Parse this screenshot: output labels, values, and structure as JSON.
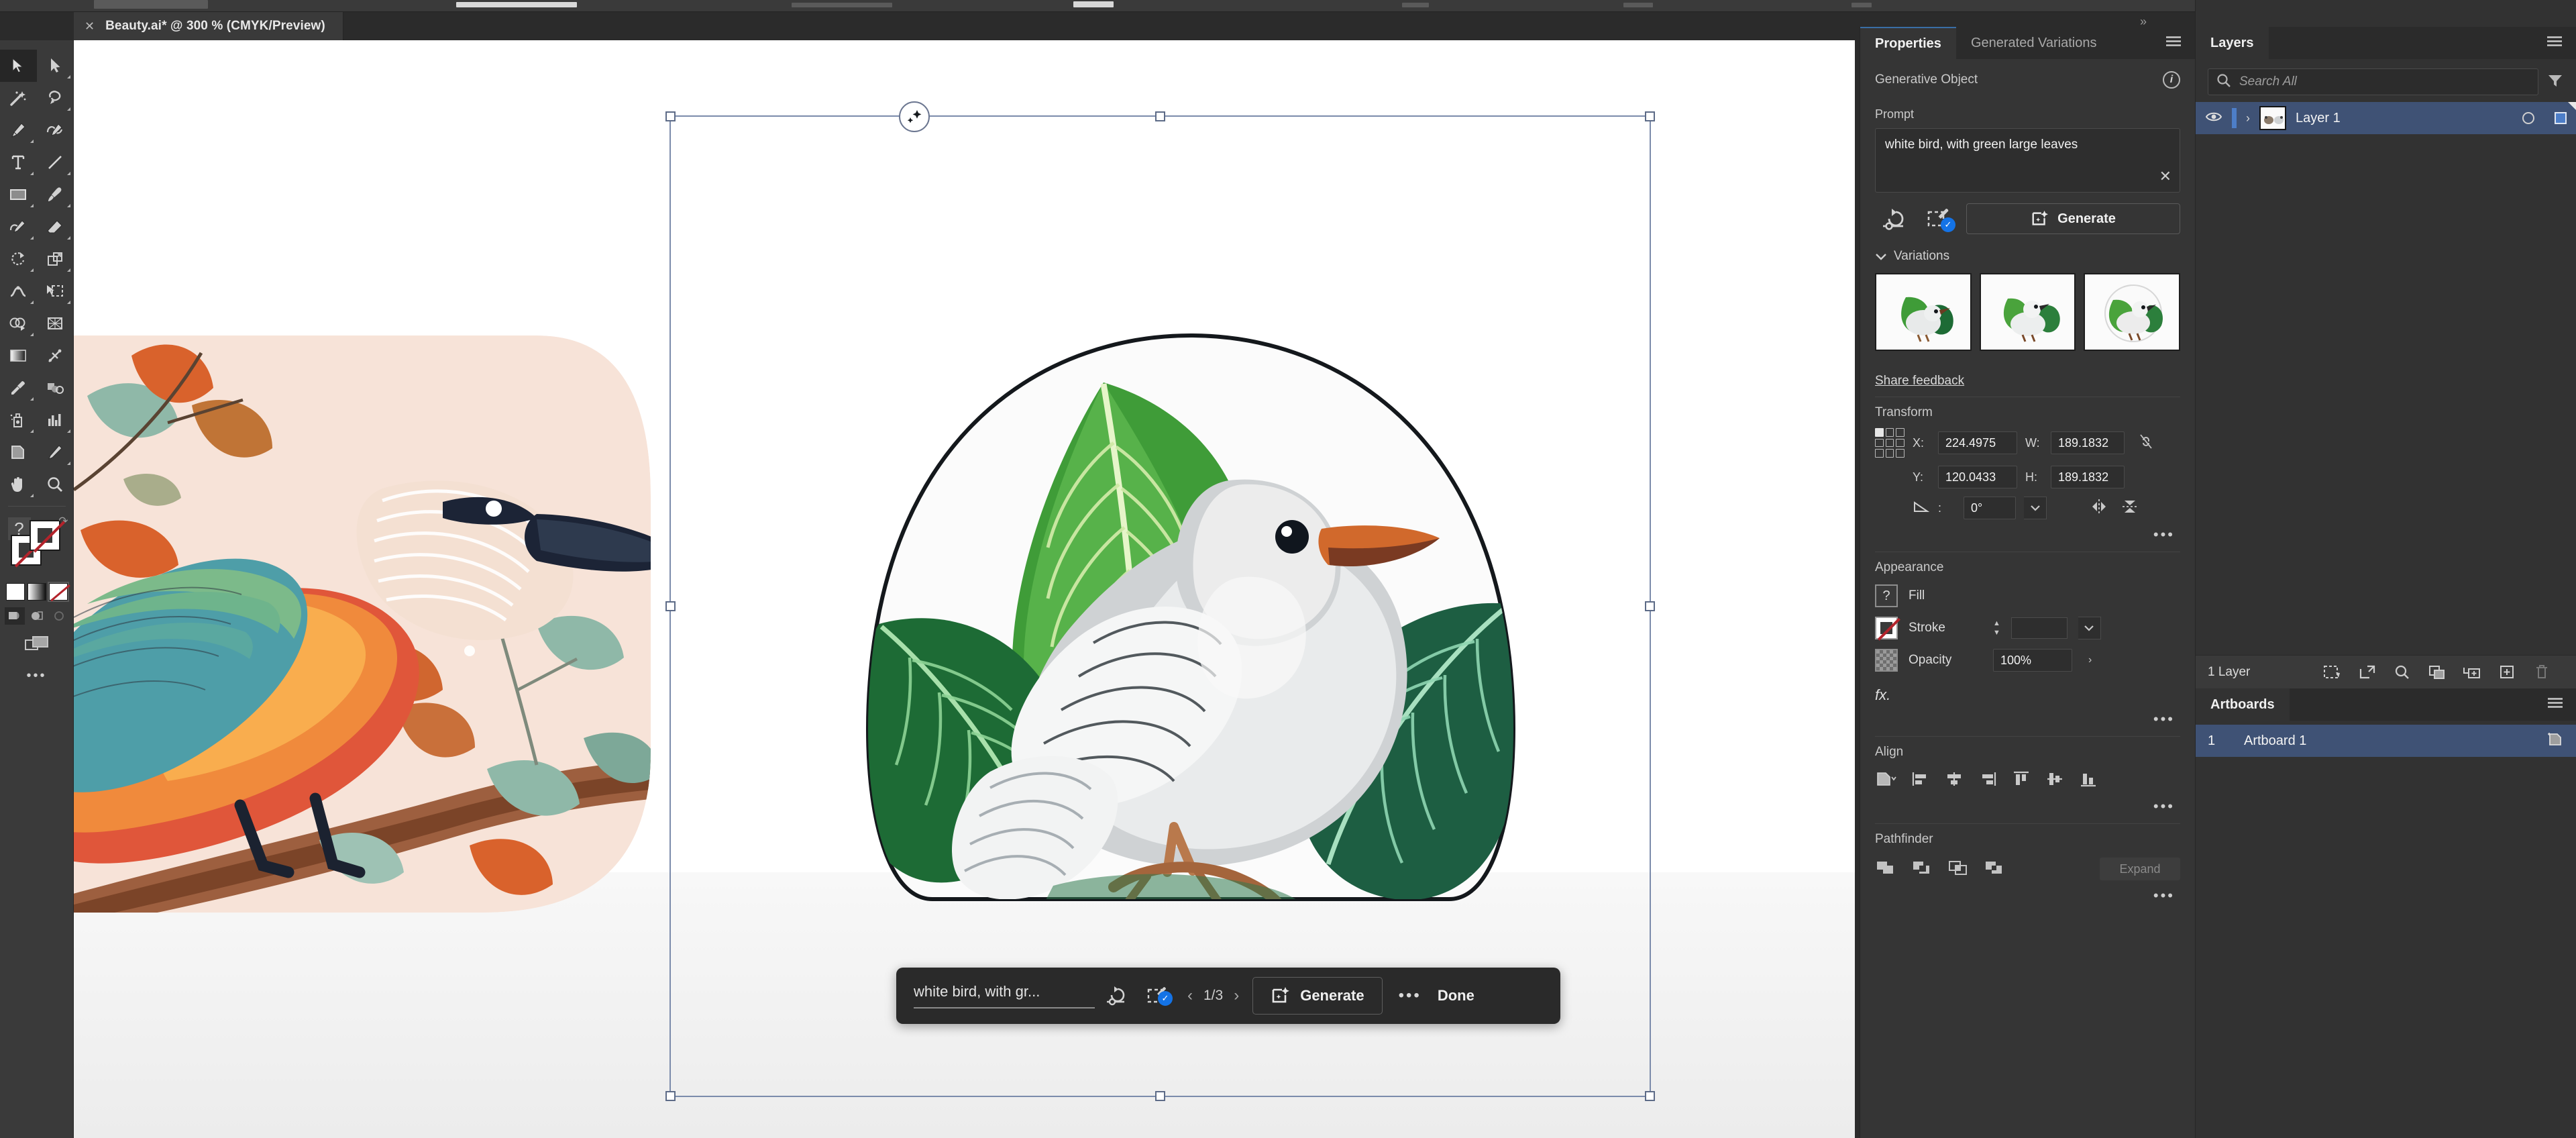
{
  "app": {
    "document_tab": {
      "title": "Beauty.ai* @ 300 % (CMYK/Preview)",
      "close_label": "✕"
    }
  },
  "toolbar": {
    "tools": [
      {
        "name": "selection-tool",
        "label": "Selection"
      },
      {
        "name": "direct-selection-tool",
        "label": "Direct Selection"
      },
      {
        "name": "magic-wand-tool",
        "label": "Magic Wand"
      },
      {
        "name": "lasso-tool",
        "label": "Lasso"
      },
      {
        "name": "pen-tool",
        "label": "Pen"
      },
      {
        "name": "curvature-tool",
        "label": "Curvature"
      },
      {
        "name": "type-tool",
        "label": "Type"
      },
      {
        "name": "line-segment-tool",
        "label": "Line Segment"
      },
      {
        "name": "rectangle-tool",
        "label": "Rectangle"
      },
      {
        "name": "paintbrush-tool",
        "label": "Paintbrush"
      },
      {
        "name": "shaper-tool",
        "label": "Shaper"
      },
      {
        "name": "eraser-tool",
        "label": "Eraser"
      },
      {
        "name": "rotate-tool",
        "label": "Rotate"
      },
      {
        "name": "scale-tool",
        "label": "Scale"
      },
      {
        "name": "width-tool",
        "label": "Width"
      },
      {
        "name": "free-transform-tool",
        "label": "Free Transform"
      },
      {
        "name": "shape-builder-tool",
        "label": "Shape Builder"
      },
      {
        "name": "perspective-grid-tool",
        "label": "Perspective Grid"
      },
      {
        "name": "gradient-tool",
        "label": "Gradient"
      },
      {
        "name": "mesh-tool",
        "label": "Mesh"
      },
      {
        "name": "eyedropper-tool",
        "label": "Eyedropper"
      },
      {
        "name": "blend-tool",
        "label": "Blend"
      },
      {
        "name": "symbol-sprayer-tool",
        "label": "Symbol Sprayer"
      },
      {
        "name": "column-graph-tool",
        "label": "Column Graph"
      },
      {
        "name": "artboard-tool",
        "label": "Artboard"
      },
      {
        "name": "slice-tool",
        "label": "Slice"
      },
      {
        "name": "hand-tool",
        "label": "Hand"
      },
      {
        "name": "zoom-tool",
        "label": "Zoom"
      }
    ],
    "selected_tool": "selection-tool",
    "fill_label": "Fill",
    "stroke_label": "Stroke",
    "fill_state": "?",
    "stroke_state": "none",
    "color_modes": [
      "color",
      "gradient",
      "none"
    ],
    "active_color_mode": "none",
    "draw_modes": [
      "draw-normal",
      "draw-behind",
      "draw-inside"
    ],
    "active_draw_mode": "draw-normal",
    "more_label": "•••"
  },
  "canvas": {
    "zoom_level": "300 %",
    "color_mode": "CMYK",
    "view_mode": "Preview",
    "selection": {
      "visible": true,
      "badge": "generative-object-badge"
    }
  },
  "gen_toolbar": {
    "prompt_text": "white bird, with gr...",
    "icons": [
      {
        "name": "generative-settings-icon"
      },
      {
        "name": "pick-color-scheme-icon",
        "checked": true
      }
    ],
    "prev_label": "‹",
    "variation_counter": "1/3",
    "next_label": "›",
    "generate_label": "Generate",
    "more_label": "•••",
    "done_label": "Done"
  },
  "properties": {
    "tabs": [
      {
        "label": "Properties",
        "active": true
      },
      {
        "label": "Generated Variations",
        "active": false
      }
    ],
    "object_type": "Generative Object",
    "prompt": {
      "label": "Prompt",
      "value": "white bird, with green large leaves",
      "clear_label": "✕"
    },
    "generate_label": "Generate",
    "variations": {
      "label": "Variations",
      "items": [
        {
          "name": "variation-1",
          "alt": "white bird with green leaves"
        },
        {
          "name": "variation-2",
          "alt": "white bird with green leaves"
        },
        {
          "name": "variation-3",
          "alt": "white bird with green leaves in circle"
        }
      ]
    },
    "share_feedback_label": "Share feedback",
    "transform": {
      "label": "Transform",
      "x_label": "X:",
      "x_value": "224.4975",
      "y_label": "Y:",
      "y_value": "120.0433",
      "w_label": "W:",
      "w_value": "189.1832",
      "h_label": "H:",
      "h_value": "189.1832",
      "angle_value": "0°",
      "link_state": "unlinked",
      "more_label": "•••"
    },
    "appearance": {
      "label": "Appearance",
      "fill_label": "Fill",
      "fill_value": "?",
      "stroke_label": "Stroke",
      "stroke_weight": "",
      "opacity_label": "Opacity",
      "opacity_value": "100%",
      "fx_label": "fx.",
      "more_label": "•••"
    },
    "align": {
      "label": "Align",
      "more_label": "•••",
      "buttons": [
        "align-to-selection",
        "align-left",
        "align-horizontal-center",
        "align-right",
        "align-top",
        "align-vertical-center",
        "align-bottom"
      ]
    },
    "pathfinder": {
      "label": "Pathfinder",
      "expand_label": "Expand",
      "more_label": "•••",
      "buttons": [
        "unite",
        "minus-front",
        "intersect",
        "exclude"
      ]
    }
  },
  "layers_panel": {
    "title": "Layers",
    "search_placeholder": "Search All",
    "rows": [
      {
        "name": "Layer 1",
        "visible": true,
        "selected": true
      }
    ],
    "footer": {
      "count_label": "1 Layer",
      "buttons": [
        "locate-object",
        "release-to-layers",
        "find-layer",
        "collect-in-new-layer",
        "create-sublayer",
        "create-new-layer",
        "delete-selection"
      ]
    }
  },
  "artboards_panel": {
    "title": "Artboards",
    "rows": [
      {
        "number": "1",
        "name": "Artboard 1",
        "selected": true
      }
    ]
  },
  "colors": {
    "panel_bg": "#353535",
    "panel_dark": "#2b2b2b",
    "selection_blue": "#3f5275",
    "accent_blue": "#1473e6",
    "layer_color": "#4d7ec8",
    "none_red": "#b3232b",
    "selection_outline": "#7b8bab"
  }
}
